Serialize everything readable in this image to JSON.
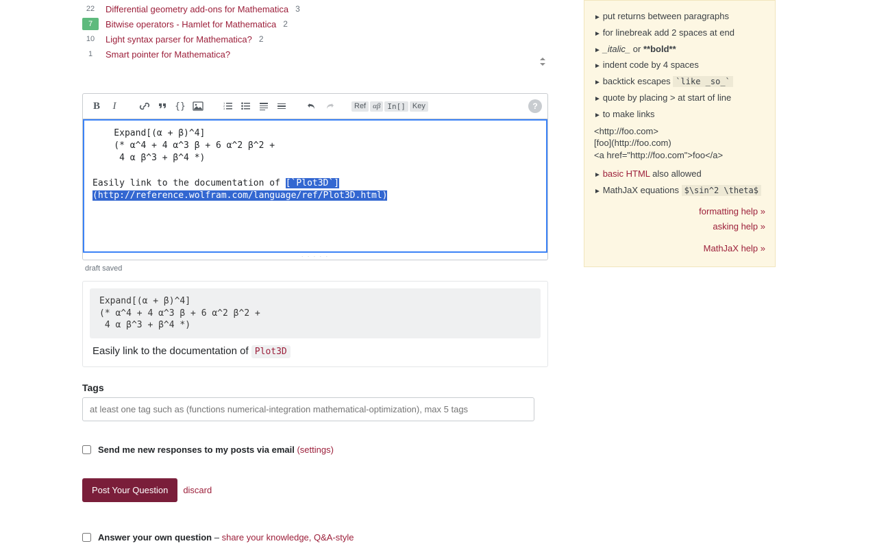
{
  "related": [
    {
      "votes": "22",
      "answered": false,
      "title": "Differential geometry add-ons for Mathematica",
      "answers": "3"
    },
    {
      "votes": "7",
      "answered": true,
      "title": "Bitwise operators - Hamlet for Mathematica",
      "answers": "2"
    },
    {
      "votes": "10",
      "answered": false,
      "title": "Light syntax parser for Mathematica?",
      "answers": "2"
    },
    {
      "votes": "1",
      "answered": false,
      "title": "Smart pointer for Mathematica?",
      "answers": ""
    }
  ],
  "editor": {
    "indent_line1": "    Expand[(α + β)^4]",
    "indent_line2": "    (* α^4 + 4 α^3 β + 6 α^2 β^2 +",
    "indent_line3": "     4 α β^3 + β^4 *)",
    "plain_lead": "Easily link to the documentation of ",
    "sel1": "[`Plot3D`]",
    "sel2": "(http://reference.wolfram.com/language/ref/Plot3D.html)"
  },
  "draft_status": "draft saved",
  "preview": {
    "code": "Expand[(α + β)^4]\n(* α^4 + 4 α^3 β + 6 α^2 β^2 +\n 4 α β^3 + β^4 *)",
    "text_lead": "Easily link to the documentation of ",
    "code_token": "Plot3D"
  },
  "tags": {
    "label": "Tags",
    "placeholder": "at least one tag such as (functions numerical-integration mathematical-optimization), max 5 tags"
  },
  "notify": {
    "label": "Send me new responses to my posts via email",
    "settings": "(settings)"
  },
  "submit": {
    "button": "Post Your Question",
    "discard": "discard"
  },
  "self_answer": {
    "label": "Answer your own question",
    "sep": " – ",
    "link": "share your knowledge, Q&A-style"
  },
  "sidebar": {
    "tips": [
      "put returns between paragraphs",
      "for linebreak add 2 spaces at end"
    ],
    "italic": "_italic_",
    "or": " or ",
    "bold": "**bold**",
    "indent": "indent code by 4 spaces",
    "backtick_lead": "backtick escapes ",
    "backtick_code": "`like _so_`",
    "quote": "quote by placing > at start of line",
    "links_lead": "to make links",
    "links_block": "<http://foo.com>\n[foo](http://foo.com)\n<a href=\"http://foo.com\">foo</a>",
    "basic_html": "basic HTML",
    "also": " also allowed",
    "mathjax_lead": "MathJaX equations ",
    "mathjax_code": "$\\sin^2 \\theta$",
    "footer": [
      "formatting help »",
      "asking help »",
      "MathJaX help »"
    ]
  }
}
